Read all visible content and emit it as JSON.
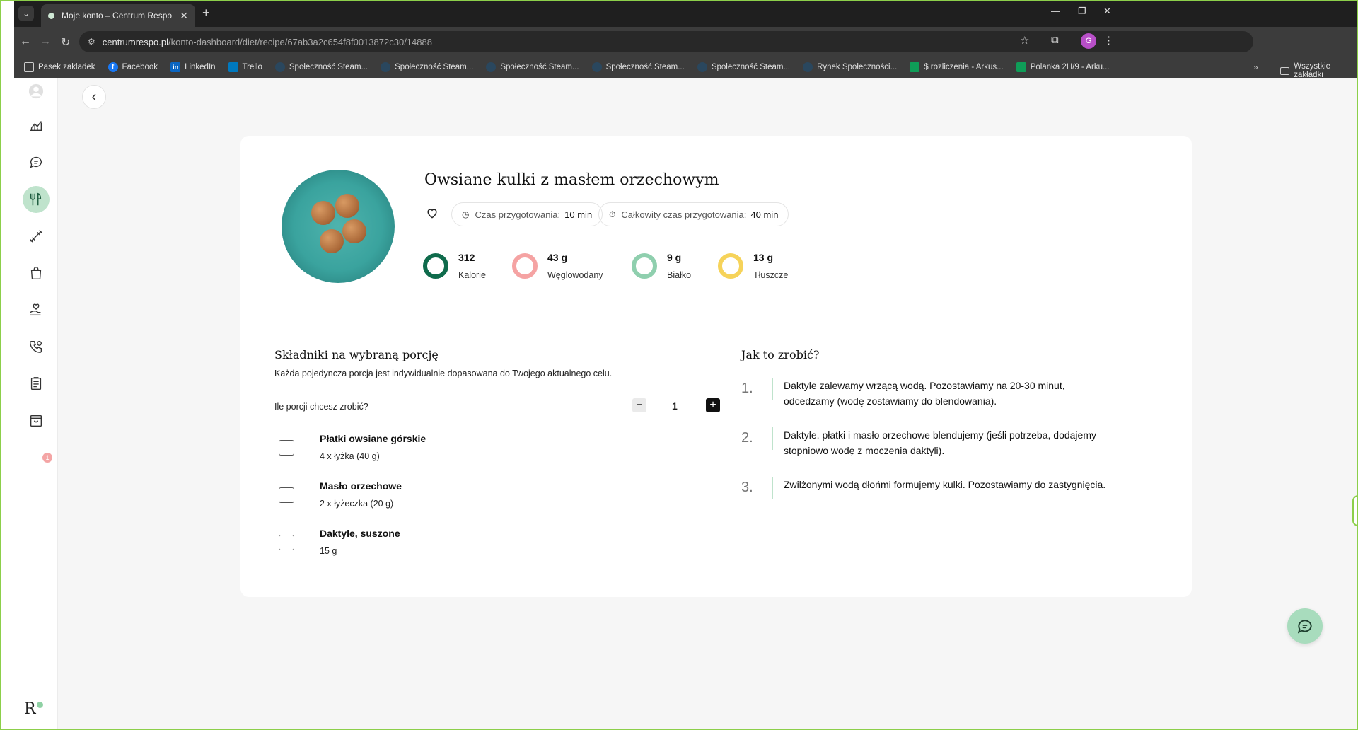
{
  "browser": {
    "tab_title": "Moje konto – Centrum Respo",
    "url_host": "centrumrespo.pl",
    "url_path": "/konto-dashboard/diet/recipe/67ab3a2c654f8f0013872c30/14888",
    "profile_initial": "G",
    "bookmarks": [
      {
        "label": "Pasek zakładek",
        "icon": "folder-icon"
      },
      {
        "label": "Facebook",
        "icon": "facebook-icon"
      },
      {
        "label": "LinkedIn",
        "icon": "linkedin-icon"
      },
      {
        "label": "Trello",
        "icon": "trello-icon"
      },
      {
        "label": "Społeczność Steam...",
        "icon": "steam-icon"
      },
      {
        "label": "Społeczność Steam...",
        "icon": "steam-icon"
      },
      {
        "label": "Społeczność Steam...",
        "icon": "steam-icon"
      },
      {
        "label": "Społeczność Steam...",
        "icon": "steam-icon"
      },
      {
        "label": "Społeczność Steam...",
        "icon": "steam-icon"
      },
      {
        "label": "Rynek Społeczności...",
        "icon": "steam-icon"
      },
      {
        "label": "$ rozliczenia - Arkus...",
        "icon": "sheets-icon"
      },
      {
        "label": "Polanka 2H/9 - Arku...",
        "icon": "sheets-icon"
      }
    ],
    "all_bookmarks": "Wszystkie zakładki"
  },
  "sidebar": {
    "badge_count": "1",
    "logo_letter": "R"
  },
  "recipe": {
    "title": "Owsiane kulki z masłem orzechowym",
    "prep_label": "Czas przygotowania:",
    "prep_value": "10 min",
    "total_label": "Całkowity czas przygotowania:",
    "total_value": "40 min",
    "macros": [
      {
        "value": "312",
        "label": "Kalorie",
        "color": "#0f6b4c"
      },
      {
        "value": "43 g",
        "label": "Węglowodany",
        "color": "#f5a3a3"
      },
      {
        "value": "9 g",
        "label": "Białko",
        "color": "#8fcfae"
      },
      {
        "value": "13 g",
        "label": "Tłuszcze",
        "color": "#f6d35a"
      }
    ]
  },
  "ingredients": {
    "title": "Składniki na wybraną porcję",
    "description": "Każda pojedyncza porcja jest indywidualnie dopasowana do Twojego aktualnego celu.",
    "portions_label": "Ile porcji chcesz zrobić?",
    "portions_value": "1",
    "items": [
      {
        "name": "Płatki owsiane górskie",
        "qty": "4 x łyżka (40 g)"
      },
      {
        "name": "Masło orzechowe",
        "qty": "2 x łyżeczka (20 g)"
      },
      {
        "name": "Daktyle, suszone",
        "qty": "15 g"
      }
    ]
  },
  "steps": {
    "title": "Jak to zrobić?",
    "items": [
      {
        "num": "1.",
        "text": "Daktyle zalewamy wrzącą wodą. Pozostawiamy na 20-30 minut, odcedzamy (wodę zostawiamy do blendowania)."
      },
      {
        "num": "2.",
        "text": "Daktyle, płatki i masło orzechowe blendujemy (jeśli potrzeba, dodajemy stopniowo wodę z moczenia daktyli)."
      },
      {
        "num": "3.",
        "text": "Zwilżonymi wodą dłońmi formujemy kulki. Pozostawiamy do zastygnięcia."
      }
    ]
  },
  "colors": {
    "accent_green": "#bfe3cc",
    "frame_green": "#8ccf4a",
    "chat_fab": "#a8dcbd"
  }
}
